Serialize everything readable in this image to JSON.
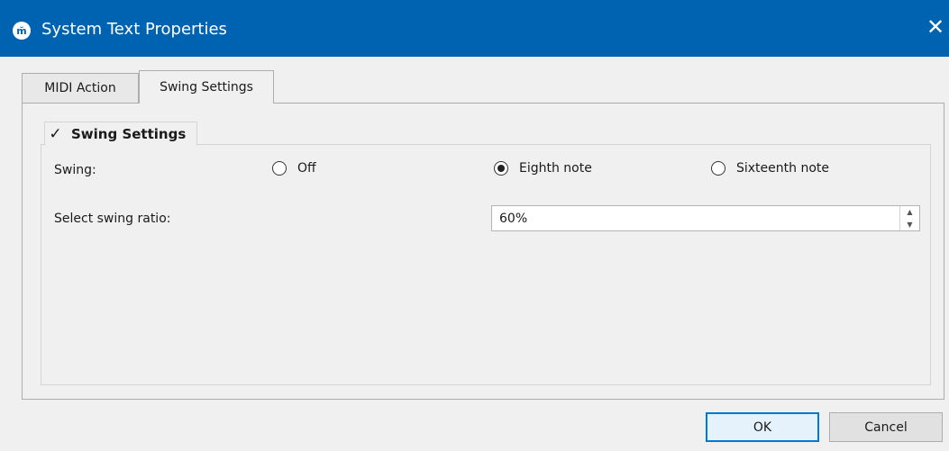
{
  "window": {
    "title": "System Text Properties",
    "app_icon_glyph": "m̆",
    "close_glyph": "✕"
  },
  "tabs": [
    {
      "label": "MIDI Action",
      "active": false
    },
    {
      "label": "Swing Settings",
      "active": true
    }
  ],
  "swing_group": {
    "checked": true,
    "check_glyph": "✓",
    "title": "Swing Settings",
    "swing_label": "Swing:",
    "options": [
      {
        "label": "Off",
        "selected": false
      },
      {
        "label": "Eighth note",
        "selected": true
      },
      {
        "label": "Sixteenth note",
        "selected": false
      }
    ],
    "ratio_label": "Select swing ratio:",
    "ratio_value": "60%",
    "spin_up_glyph": "▲",
    "spin_down_glyph": "▼"
  },
  "buttons": {
    "ok": "OK",
    "cancel": "Cancel"
  },
  "colors": {
    "titlebar": "#0063b1",
    "default_button_border": "#0078d7"
  }
}
